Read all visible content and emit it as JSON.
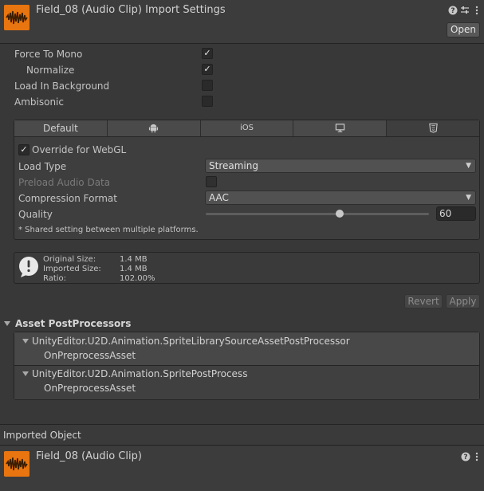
{
  "header": {
    "title": "Field_08 (Audio Clip) Import Settings",
    "help_icon": "help-icon",
    "presets_icon": "presets-icon",
    "menu_icon": "kebab-menu-icon",
    "open_label": "Open"
  },
  "settings": {
    "force_to_mono": {
      "label": "Force To Mono",
      "checked": true
    },
    "normalize": {
      "label": "Normalize",
      "checked": true
    },
    "load_in_background": {
      "label": "Load In Background",
      "checked": false
    },
    "ambisonic": {
      "label": "Ambisonic",
      "checked": false
    }
  },
  "platform_tabs": {
    "default_label": "Default",
    "ios_label": "iOS",
    "icons": [
      "android-icon",
      "monitor-icon",
      "html5-icon"
    ]
  },
  "webgl": {
    "override_label": "Override for WebGL",
    "override_checked": true,
    "load_type_label": "Load Type",
    "load_type_value": "Streaming",
    "preload_label": "Preload Audio Data",
    "preload_checked": false,
    "compression_label": "Compression Format",
    "compression_value": "AAC",
    "quality_label": "Quality",
    "quality_value": "60",
    "quality_fraction": 0.6,
    "shared_note": "* Shared setting between multiple platforms."
  },
  "info": {
    "icon": "warning-info-icon",
    "original_size_label": "Original Size:",
    "original_size_value": "1.4 MB",
    "imported_size_label": "Imported Size:",
    "imported_size_value": "1.4 MB",
    "ratio_label": "Ratio:",
    "ratio_value": "102.00%"
  },
  "actions": {
    "revert_label": "Revert",
    "apply_label": "Apply"
  },
  "postprocessors": {
    "title": "Asset PostProcessors",
    "items": [
      {
        "name": "UnityEditor.U2D.Animation.SpriteLibrarySourceAssetPostProcessor",
        "method": "OnPreprocessAsset"
      },
      {
        "name": "UnityEditor.U2D.Animation.SpritePostProcess",
        "method": "OnPreprocessAsset"
      }
    ]
  },
  "imported_object": {
    "section_label": "Imported Object",
    "title": "Field_08 (Audio Clip)"
  },
  "colors": {
    "accent_orange": "#e8750f",
    "background": "#383838"
  }
}
